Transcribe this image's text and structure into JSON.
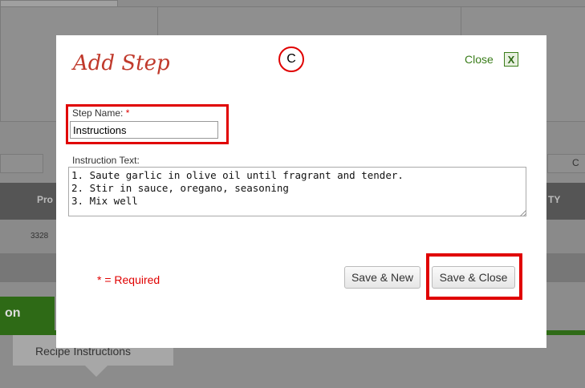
{
  "background": {
    "table_headers": [
      "Pro",
      "TY"
    ],
    "row_value": "3328",
    "tab_label": "on",
    "recipe_button": "Recipe Instructions",
    "filter_button": "C"
  },
  "modal": {
    "title": "Add Step",
    "annotation": "C",
    "close_label": "Close",
    "close_icon": "X",
    "step_name_label": "Step Name:",
    "required_star": "*",
    "step_name_value": "Instructions",
    "instruction_label": "Instruction Text:",
    "instruction_value": "1. Saute garlic in olive oil until fragrant and tender.\n2. Stir in sauce, oregano, seasoning\n3. Mix well",
    "required_note": "* = Required",
    "save_new_label": "Save & New",
    "save_close_label": "Save & Close"
  },
  "colors": {
    "accent_red": "#c0392b",
    "highlight": "#e00000",
    "green": "#2e6a16"
  }
}
